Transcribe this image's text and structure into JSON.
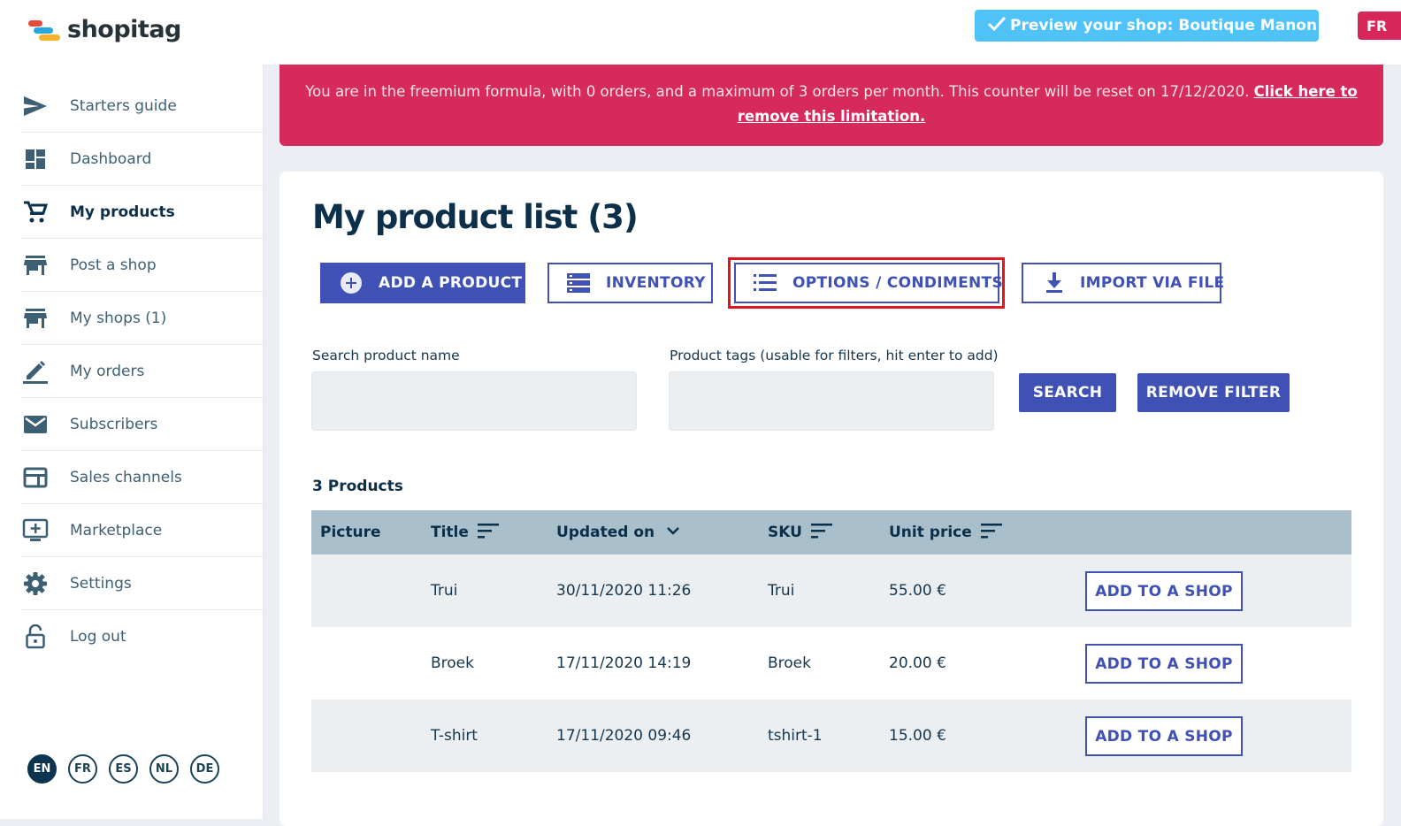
{
  "brand": {
    "name": "shopitag"
  },
  "sidebar": {
    "items": [
      {
        "label": "Starters guide",
        "icon": "send-icon"
      },
      {
        "label": "Dashboard",
        "icon": "dashboard-icon"
      },
      {
        "label": "My products",
        "icon": "cart-icon",
        "active": true
      },
      {
        "label": "Post a shop",
        "icon": "store-icon"
      },
      {
        "label": "My shops (1)",
        "icon": "store-icon"
      },
      {
        "label": "My orders",
        "icon": "pencil-icon"
      },
      {
        "label": "Subscribers",
        "icon": "mail-icon"
      },
      {
        "label": "Sales channels",
        "icon": "channel-icon"
      },
      {
        "label": "Marketplace",
        "icon": "add-to-screen-icon"
      },
      {
        "label": "Settings",
        "icon": "gear-icon"
      },
      {
        "label": "Log out",
        "icon": "lock-icon"
      }
    ],
    "languages": [
      "EN",
      "FR",
      "ES",
      "NL",
      "DE"
    ],
    "active_language": "EN"
  },
  "topbar": {
    "preview_label": "Preview your shop: Boutique Manon",
    "lang_badge": "FR"
  },
  "banner": {
    "text": "You are in the freemium formula, with 0 orders, and a maximum of 3 orders per month. This counter will be reset on 17/12/2020.",
    "link": "Click here to remove this limitation."
  },
  "page": {
    "title": "My product list (3)",
    "actions": {
      "add_product": "ADD A PRODUCT",
      "inventory": "INVENTORY",
      "options": "OPTIONS / CONDIMENTS",
      "import": "IMPORT VIA FILE"
    },
    "filters": {
      "search_label": "Search product name",
      "search_value": "",
      "tags_label": "Product tags (usable for filters, hit enter to add)",
      "tags_value": "",
      "search_button": "SEARCH",
      "remove_button": "REMOVE FILTER"
    },
    "count_label": "3 Products"
  },
  "table": {
    "headers": {
      "picture": "Picture",
      "title": "Title",
      "updated": "Updated on",
      "sku": "SKU",
      "price": "Unit price"
    },
    "action_label": "ADD TO A SHOP",
    "rows": [
      {
        "title": "Trui",
        "updated": "30/11/2020 11:26",
        "sku": "Trui",
        "price": "55.00 €"
      },
      {
        "title": "Broek",
        "updated": "17/11/2020 14:19",
        "sku": "Broek",
        "price": "20.00 €"
      },
      {
        "title": "T-shirt",
        "updated": "17/11/2020 09:46",
        "sku": "tshirt-1",
        "price": "15.00 €"
      }
    ]
  },
  "colors": {
    "primary": "#3f51b5",
    "banner": "#d6295c",
    "preview": "#4fc3f7",
    "header_row": "#a9bfcb",
    "highlight": "#e0131e"
  }
}
